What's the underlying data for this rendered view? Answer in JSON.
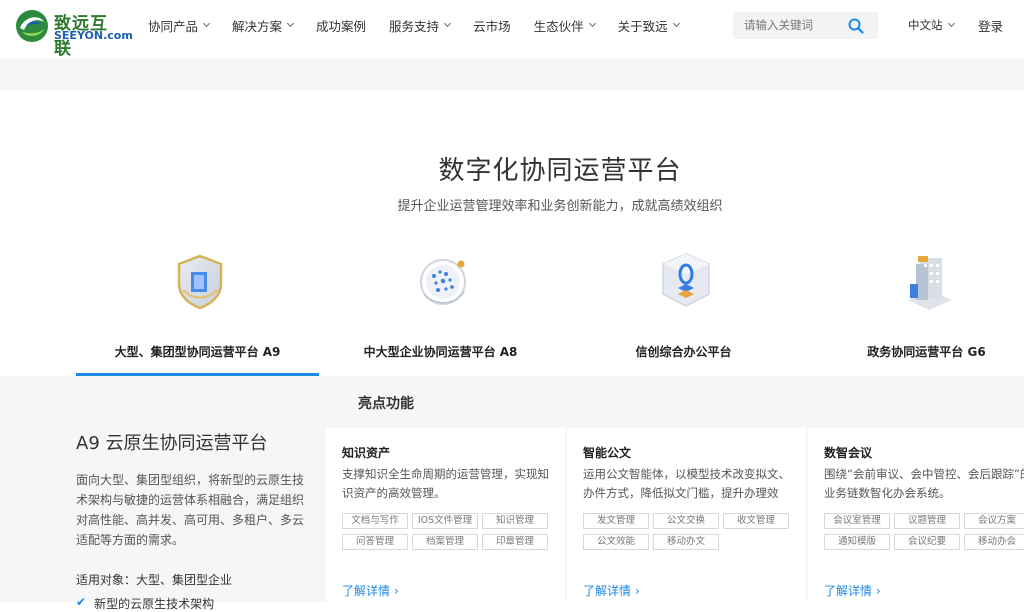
{
  "header": {
    "logo_cn": "致远互联",
    "logo_en": "SEEYON.com",
    "nav": [
      {
        "label": "协同产品",
        "has_dropdown": true
      },
      {
        "label": "解决方案",
        "has_dropdown": true
      },
      {
        "label": "成功案例",
        "has_dropdown": false
      },
      {
        "label": "服务支持",
        "has_dropdown": true
      },
      {
        "label": "云市场",
        "has_dropdown": false
      },
      {
        "label": "生态伙伴",
        "has_dropdown": true
      },
      {
        "label": "关于致远",
        "has_dropdown": true
      }
    ],
    "search_placeholder": "请输入关键词",
    "lang": "中文站",
    "login": "登录"
  },
  "hero": {
    "title": "数字化协同运营平台",
    "subtitle": "提升企业运营管理效率和业务创新能力，成就高绩效组织"
  },
  "tabs": [
    {
      "label": "大型、集团型协同运营平台 A9",
      "icon": "shield-icon",
      "active": true
    },
    {
      "label": "中大型企业协同运营平台 A8",
      "icon": "globe-icon",
      "active": false
    },
    {
      "label": "信创综合办公平台",
      "icon": "cube-icon",
      "active": false
    },
    {
      "label": "政务协同运营平台 G6",
      "icon": "building-icon",
      "active": false
    }
  ],
  "detail": {
    "title": "A9 云原生协同运营平台",
    "description": "面向大型、集团型组织，将新型的云原生技术架构与敏捷的运营体系相融合，满足组织对高性能、高并发、高可用、多租户、多云适配等方面的需求。",
    "target": "适用对象：大型、集团型企业",
    "check_item": "新型的云原生技术架构"
  },
  "highlights": {
    "title": "亮点功能",
    "cards": [
      {
        "title": "知识资产",
        "desc": "支撑知识全生命周期的运营管理，实现知识资产的高效管理。",
        "chips": [
          "文档与写作",
          "IOS文件管理",
          "知识管理",
          "问答管理",
          "档案管理",
          "印章管理"
        ],
        "more": "了解详情"
      },
      {
        "title": "智能公文",
        "desc": "运用公文智能体，以模型技术改变拟文、办件方式，降低拟文门槛，提升办理效",
        "chips": [
          "发文管理",
          "公文交换",
          "收文管理",
          "公文效能",
          "移动办文"
        ],
        "more": "了解详情"
      },
      {
        "title": "数智会议",
        "desc": "围绕“会前审议、会中管控、会后跟踪”的业务链数智化办会系统。",
        "chips": [
          "会议室管理",
          "议题管理",
          "会议方案",
          "通知模版",
          "会议纪要",
          "移动办会"
        ],
        "more": "了解详情"
      }
    ]
  },
  "colors": {
    "accent": "#1e88e5",
    "logo_green": "#2b7a2e",
    "panel_bg": "#f5f6f8"
  }
}
